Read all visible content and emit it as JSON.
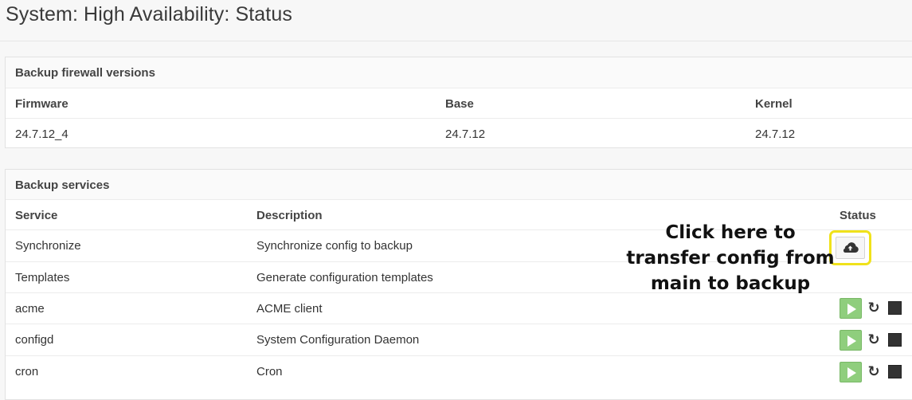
{
  "page": {
    "title": "System: High Availability: Status"
  },
  "versions": {
    "heading": "Backup firewall versions",
    "headers": {
      "firmware": "Firmware",
      "base": "Base",
      "kernel": "Kernel"
    },
    "values": {
      "firmware": "24.7.12_4",
      "base": "24.7.12",
      "kernel": "24.7.12"
    }
  },
  "services": {
    "heading": "Backup services",
    "headers": {
      "service": "Service",
      "description": "Description",
      "status": "Status"
    },
    "rows": [
      {
        "service": "Synchronize",
        "description": "Synchronize config to backup"
      },
      {
        "service": "Templates",
        "description": "Generate configuration templates"
      },
      {
        "service": "acme",
        "description": "ACME client"
      },
      {
        "service": "configd",
        "description": "System Configuration Daemon"
      },
      {
        "service": "cron",
        "description": "Cron"
      }
    ]
  },
  "annotation": {
    "text": "Click here to transfer config from main to backup",
    "highlight_color": "#f0e21b"
  },
  "icons": {
    "sync": "cloud-upload-icon",
    "start": "play-icon",
    "restart": "restart-icon",
    "stop": "stop-icon"
  },
  "colors": {
    "start_button": "#8fce7d",
    "background": "#f7f7f7"
  }
}
